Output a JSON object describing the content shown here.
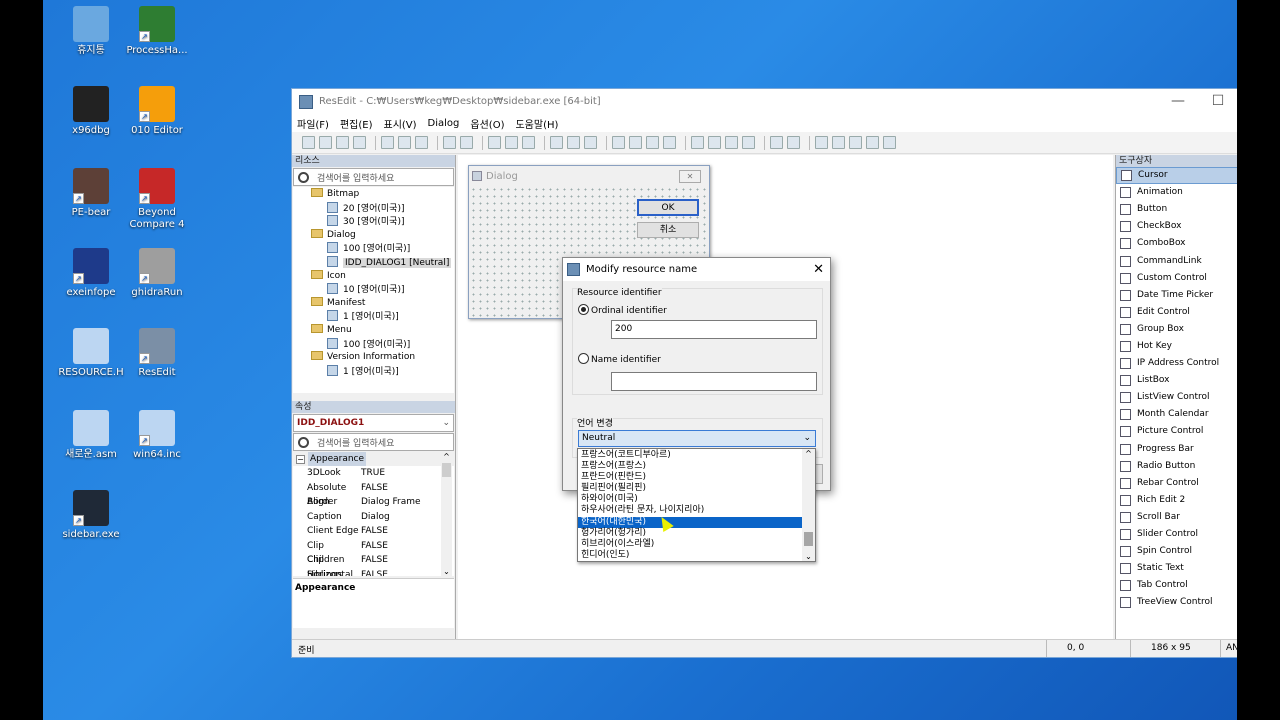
{
  "desktop_icons": [
    {
      "label": "휴지통",
      "icon": "recycle-bin-icon"
    },
    {
      "label": "ProcessHa...",
      "icon": "process-hacker-icon"
    },
    {
      "label": "x96dbg",
      "icon": "bug-icon"
    },
    {
      "label": "010 Editor",
      "icon": "editor-icon"
    },
    {
      "label": "PE-bear",
      "icon": "bear-icon"
    },
    {
      "label": "Beyond Compare 4",
      "icon": "compare-icon"
    },
    {
      "label": "exeinfope",
      "icon": "exe-icon"
    },
    {
      "label": "ghidraRun",
      "icon": "ghidra-icon"
    },
    {
      "label": "RESOURCE.H",
      "icon": "file-icon"
    },
    {
      "label": "ResEdit",
      "icon": "resedit-icon"
    },
    {
      "label": "새로운.asm",
      "icon": "file-icon"
    },
    {
      "label": "win64.inc",
      "icon": "file-icon"
    },
    {
      "label": "sidebar.exe",
      "icon": "monitor-icon"
    }
  ],
  "window": {
    "title": "ResEdit - C:₩Users₩keg₩Desktop₩sidebar.exe [64-bit]"
  },
  "menu": [
    "파일(F)",
    "편집(E)",
    "표시(V)",
    "Dialog",
    "옵션(O)",
    "도움말(H)"
  ],
  "resources_panel": {
    "title": "리소스",
    "search_placeholder": "검색어를 입력하세요",
    "tree": [
      {
        "text": "Bitmap",
        "level": 1,
        "type": "folder"
      },
      {
        "text": "20 [영어(미국)]",
        "level": 2,
        "type": "bitmap"
      },
      {
        "text": "30 [영어(미국)]",
        "level": 2,
        "type": "bitmap"
      },
      {
        "text": "Dialog",
        "level": 1,
        "type": "folder"
      },
      {
        "text": "100 [영어(미국)]",
        "level": 2,
        "type": "dialog"
      },
      {
        "text": "IDD_DIALOG1 [Neutral]",
        "level": 2,
        "type": "dialog",
        "selected": true
      },
      {
        "text": "Icon",
        "level": 1,
        "type": "folder"
      },
      {
        "text": "10 [영어(미국)]",
        "level": 2,
        "type": "icon"
      },
      {
        "text": "Manifest",
        "level": 1,
        "type": "folder"
      },
      {
        "text": "1 [영어(미국)]",
        "level": 2,
        "type": "manifest"
      },
      {
        "text": "Menu",
        "level": 1,
        "type": "folder"
      },
      {
        "text": "100 [영어(미국)]",
        "level": 2,
        "type": "menu"
      },
      {
        "text": "Version Information",
        "level": 1,
        "type": "folder"
      },
      {
        "text": "1 [영어(미국)]",
        "level": 2,
        "type": "version"
      }
    ]
  },
  "properties_panel": {
    "title": "속성",
    "selected_object": "IDD_DIALOG1",
    "search_placeholder": "검색어를 입력하세요",
    "category": "Appearance",
    "rows": [
      {
        "key": "3DLook",
        "value": "TRUE"
      },
      {
        "key": "Absolute Align",
        "value": "FALSE"
      },
      {
        "key": "Border",
        "value": "Dialog Frame"
      },
      {
        "key": "Caption",
        "value": "Dialog"
      },
      {
        "key": "Client Edge",
        "value": "FALSE"
      },
      {
        "key": "Clip Children",
        "value": "FALSE"
      },
      {
        "key": "Clip Siblings",
        "value": "FALSE"
      },
      {
        "key": "Horizontal Scroll",
        "value": "FALSE"
      }
    ],
    "description_title": "Appearance"
  },
  "preview_dialog": {
    "title": "Dialog",
    "ok": "OK",
    "cancel": "취소"
  },
  "modal": {
    "title": "Modify resource name",
    "group1": "Resource identifier",
    "ordinal_label": "Ordinal identifier",
    "ordinal_value": "200",
    "name_label": "Name identifier",
    "name_value": "",
    "group2": "언어 변경",
    "language_selected": "Neutral",
    "language_options": [
      "프랑스어(코트디부아르)",
      "프랑스어(프랑스)",
      "프란드어(핀란드)",
      "필리핀어(필리핀)",
      "하와이어(미국)",
      "하우사어(라틴 문자, 나이지리아)",
      "한국어(대한민국)",
      "헝가리어(헝가리)",
      "히브리어(이스라엘)",
      "힌디어(인도)"
    ],
    "language_highlighted": "한국어(대한민국)"
  },
  "toolbox": {
    "title": "도구상자",
    "items": [
      "Cursor",
      "Animation",
      "Button",
      "CheckBox",
      "ComboBox",
      "CommandLink",
      "Custom Control",
      "Date Time Picker",
      "Edit Control",
      "Group Box",
      "Hot Key",
      "IP Address Control",
      "ListBox",
      "ListView Control",
      "Month Calendar",
      "Picture Control",
      "Progress Bar",
      "Radio Button",
      "Rebar Control",
      "Rich Edit 2",
      "Scroll Bar",
      "Slider Control",
      "Spin Control",
      "Static Text",
      "Tab Control",
      "TreeView Control"
    ]
  },
  "status": {
    "ready": "준비",
    "position": "0, 0",
    "size": "186 x 95",
    "encoding": "ANSI"
  }
}
